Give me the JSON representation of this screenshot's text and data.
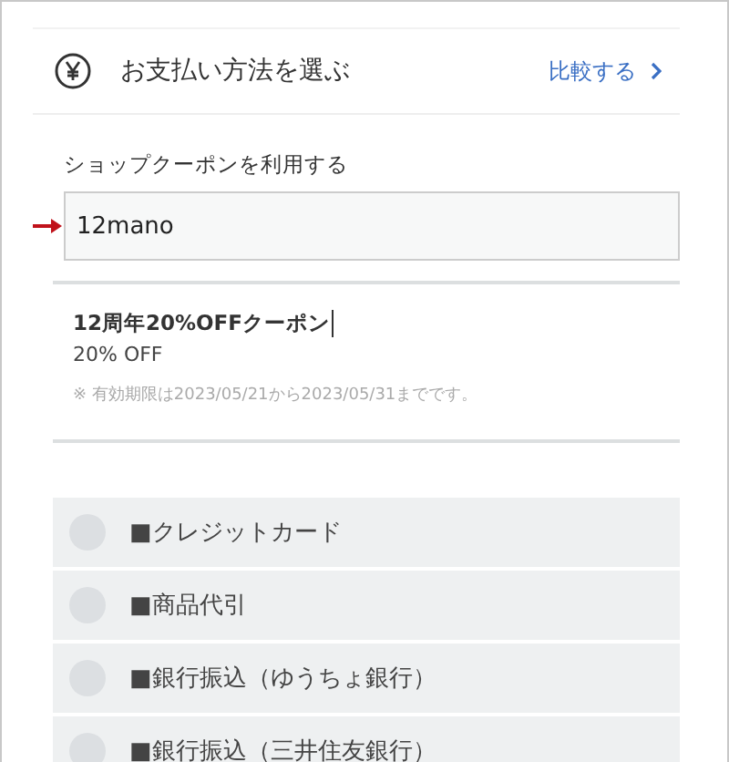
{
  "header": {
    "title": "お支払い方法を選ぶ",
    "link": "比較する"
  },
  "coupon_field": {
    "label": "ショップクーポンを利用する",
    "value": "12mano"
  },
  "coupon": {
    "name": "12周年20%OFFクーポン",
    "discount": "20% OFF",
    "note": "※ 有効期限は2023/05/21から2023/05/31までです。"
  },
  "payment_methods": [
    {
      "label": "■クレジットカード",
      "selected": false
    },
    {
      "label": "■商品代引",
      "selected": false
    },
    {
      "label": "■銀行振込（ゆうちょ銀行）",
      "selected": false
    },
    {
      "label": "■銀行振込（三井住友銀行）",
      "selected": false
    }
  ]
}
